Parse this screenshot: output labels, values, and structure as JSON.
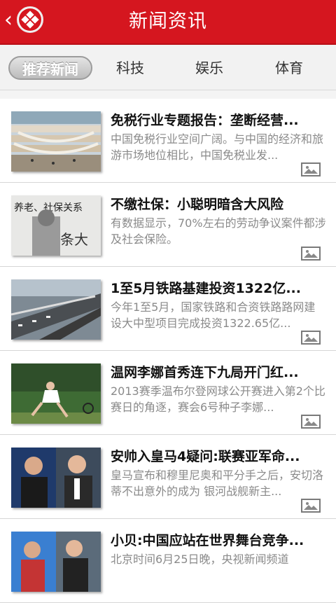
{
  "header": {
    "back_glyph": "‹",
    "title": "新闻资讯",
    "brand_color": "#d5161f"
  },
  "tabs": [
    {
      "label": "推荐新闻",
      "active": true
    },
    {
      "label": "科技",
      "active": false
    },
    {
      "label": "娱乐",
      "active": false
    },
    {
      "label": "体育",
      "active": false
    }
  ],
  "news": [
    {
      "headline": "免税行业专题报告：垄断经营...",
      "summary": "中国免税行业空间广阔。与中国的经济和旅游市场地位相比，中国免税业发...",
      "thumb": "mall-atrium",
      "has_image_icon": true
    },
    {
      "headline": "不缴社保：小聪明暗含大风险",
      "summary": "有数据显示，70%左右的劳动争议案件都涉及社会保险。",
      "thumb": "social-insurance-poster",
      "has_image_icon": true
    },
    {
      "headline": "1至5月铁路基建投资1322亿...",
      "summary": "今年1至5月，国家铁路和合资铁路路网建设大中型项目完成投资1322.65亿...",
      "thumb": "highway-train",
      "has_image_icon": true
    },
    {
      "headline": "温网李娜首秀连下九局开门红...",
      "summary": "2013赛季温布尔登网球公开赛进入第2个比赛日的角逐，赛会6号种子李娜...",
      "thumb": "tennis-player",
      "has_image_icon": true
    },
    {
      "headline": "安帅入皇马4疑问:联赛亚军命...",
      "summary": "皇马宣布和穆里尼奥和平分手之后，安切洛蒂不出意外的成为 银河战舰新主...",
      "thumb": "football-coaches",
      "has_image_icon": true
    },
    {
      "headline": "小贝:中国应站在世界舞台竞争...",
      "summary": "北京时间6月25日晚，央视新闻频道",
      "thumb": "beckham-interview",
      "has_image_icon": false
    }
  ]
}
